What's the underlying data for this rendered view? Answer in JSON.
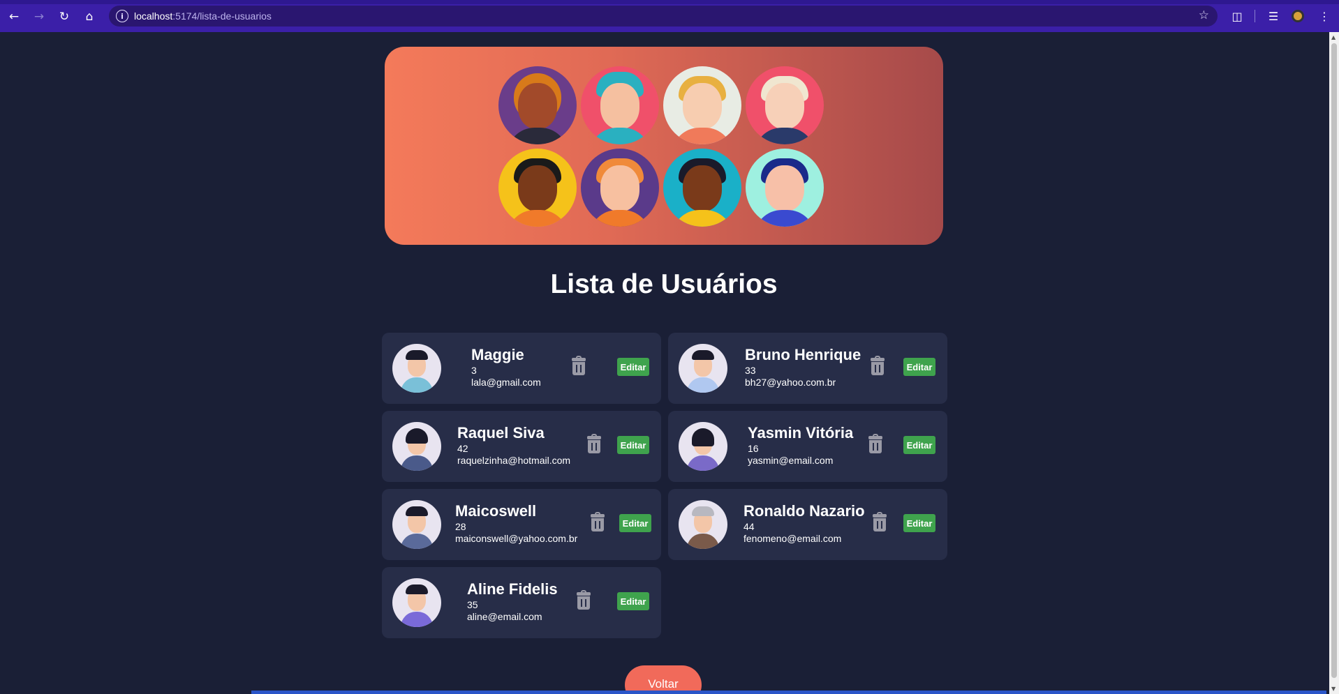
{
  "browser": {
    "url_host": "localhost",
    "url_path": ":5174/lista-de-usuarios"
  },
  "page": {
    "title": "Lista de Usuários",
    "back_button": "Voltar"
  },
  "users": [
    {
      "name": "Maggie",
      "age": "3",
      "email": "lala@gmail.com",
      "edit_label": "Editar"
    },
    {
      "name": "Bruno Henrique",
      "age": "33",
      "email": "bh27@yahoo.com.br",
      "edit_label": "Editar"
    },
    {
      "name": "Raquel Siva",
      "age": "42",
      "email": "raquelzinha@hotmail.com",
      "edit_label": "Editar"
    },
    {
      "name": "Yasmin Vitória",
      "age": "16",
      "email": "yasmin@email.com",
      "edit_label": "Editar"
    },
    {
      "name": "Maicoswell",
      "age": "28",
      "email": "maiconswell@yahoo.com.br",
      "edit_label": "Editar"
    },
    {
      "name": "Ronaldo Nazario",
      "age": "44",
      "email": "fenomeno@email.com",
      "edit_label": "Editar"
    },
    {
      "name": "Aline Fidelis",
      "age": "35",
      "email": "aline@email.com",
      "edit_label": "Editar"
    }
  ],
  "colors": {
    "background": "#1a1f36",
    "card": "#272d48",
    "edit_button": "#3fa34d",
    "back_button": "#f16a5a",
    "banner_start": "#f47a5a",
    "banner_end": "#a64a4a",
    "browser_chrome": "#3b1fa8"
  },
  "icons": {
    "back": "arrow-left-icon",
    "forward": "arrow-right-icon",
    "reload": "reload-icon",
    "home": "home-icon",
    "site_info": "info-icon",
    "bookmark": "star-icon",
    "extensions": "puzzle-icon",
    "media": "media-control-icon",
    "menu": "kebab-menu-icon",
    "delete": "trash-icon"
  }
}
